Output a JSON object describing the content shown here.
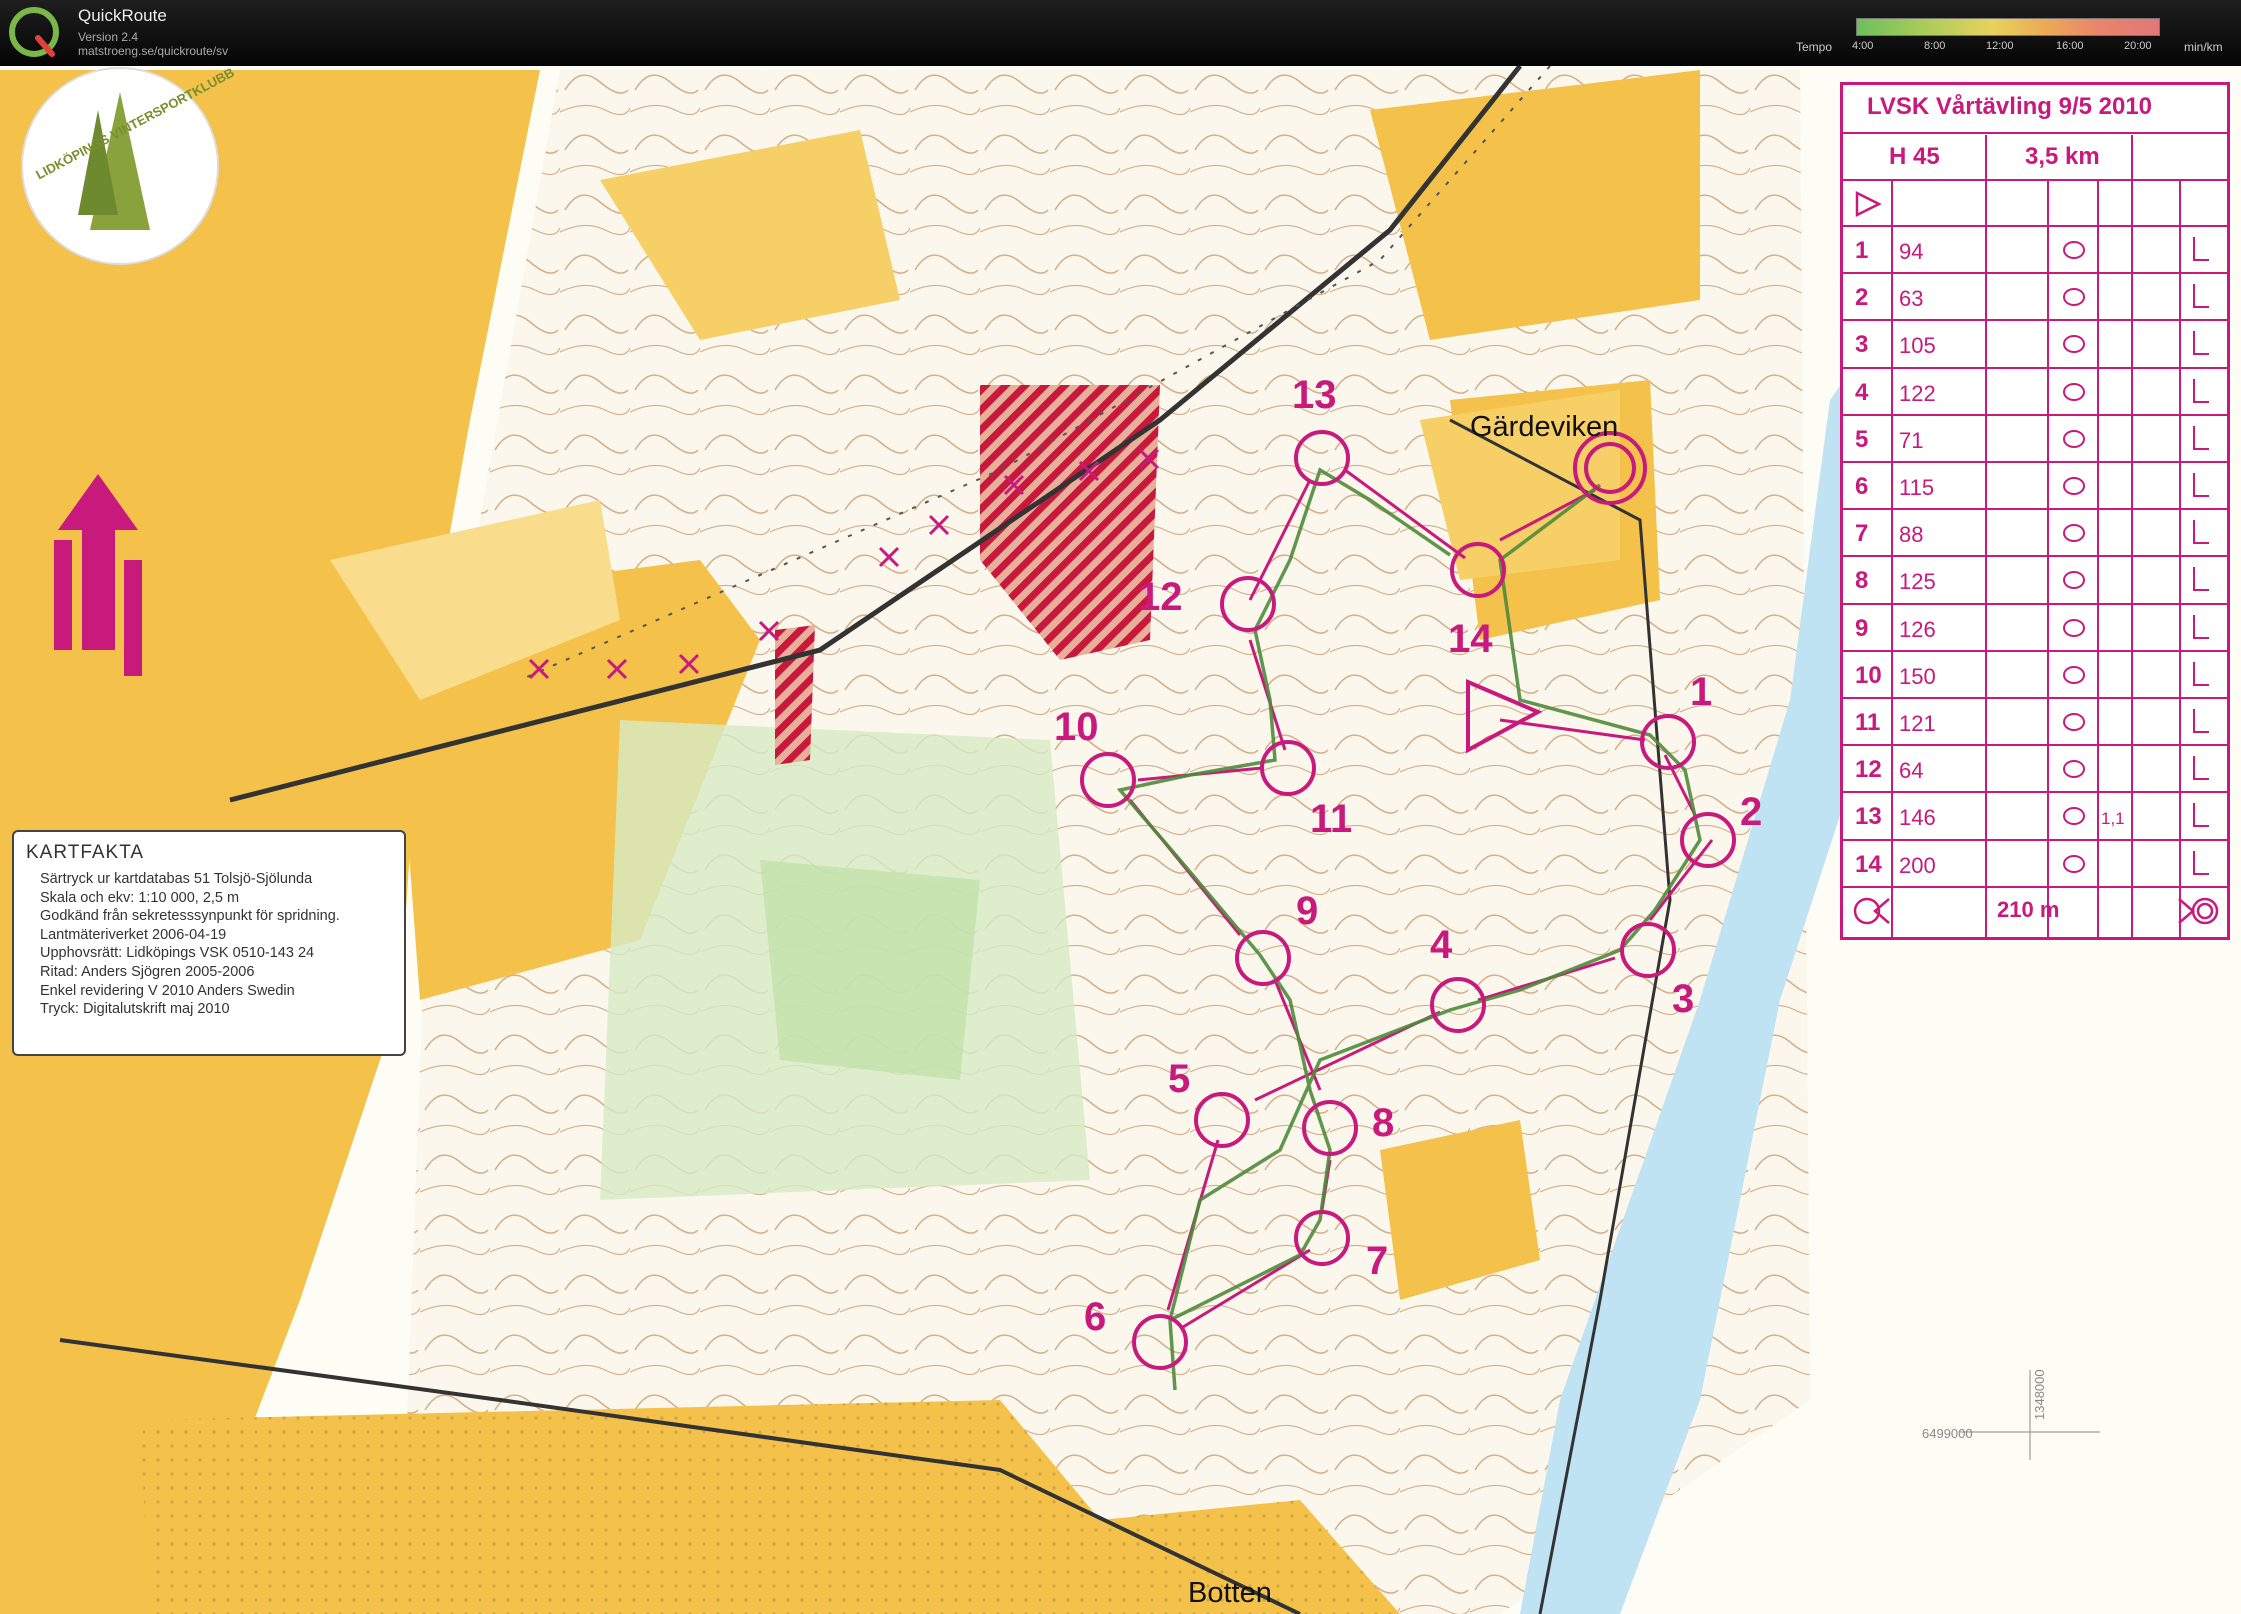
{
  "app": {
    "name": "QuickRoute",
    "version": "Version 2.4",
    "url": "matstroeng.se/quickroute/sv"
  },
  "tempo": {
    "label": "Tempo",
    "ticks": [
      "4:00",
      "8:00",
      "12:00",
      "16:00",
      "20:00"
    ],
    "unit": "min/km",
    "colors": [
      "#6dbf5b",
      "#e8d25c",
      "#e07878"
    ]
  },
  "map": {
    "club_logo_text": "LIDKÖPINGS VINTERSPORTKLUBB",
    "place_names": [
      "Gärdeviken",
      "Botten"
    ],
    "grid_ref_1": "6499000",
    "grid_ref_2": "1348000",
    "course_color": "#c8197d",
    "route_color": "#4f8a3c",
    "control_numbers": [
      "1",
      "2",
      "3",
      "4",
      "5",
      "6",
      "7",
      "8",
      "9",
      "10",
      "11",
      "12",
      "13",
      "14"
    ]
  },
  "kartfakta": {
    "title": "KARTFAKTA",
    "lines": [
      "Särtryck ur kartdatabas 51 Tolsjö-Sjölunda",
      "Skala och ekv: 1:10 000, 2,5 m",
      "Godkänd från sekretesssynpunkt för spridning.",
      "Lantmäteriverket 2006-04-19",
      "Upphovsrätt: Lidköpings VSK 0510-143 24",
      "Ritad: Anders Sjögren 2005-2006",
      "Enkel revidering V 2010 Anders Swedin",
      "Tryck: Digitalutskrift maj 2010"
    ]
  },
  "description": {
    "event": "LVSK Vårtävling 9/5 2010",
    "class": "H 45",
    "length": "3,5 km",
    "controls": [
      {
        "n": "1",
        "code": "94"
      },
      {
        "n": "2",
        "code": "63"
      },
      {
        "n": "3",
        "code": "105"
      },
      {
        "n": "4",
        "code": "122"
      },
      {
        "n": "5",
        "code": "71"
      },
      {
        "n": "6",
        "code": "115"
      },
      {
        "n": "7",
        "code": "88"
      },
      {
        "n": "8",
        "code": "125"
      },
      {
        "n": "9",
        "code": "126"
      },
      {
        "n": "10",
        "code": "150"
      },
      {
        "n": "11",
        "code": "121"
      },
      {
        "n": "12",
        "code": "64"
      },
      {
        "n": "13",
        "code": "146",
        "extra": "1,1"
      },
      {
        "n": "14",
        "code": "200"
      }
    ],
    "finish_distance": "210 m"
  }
}
